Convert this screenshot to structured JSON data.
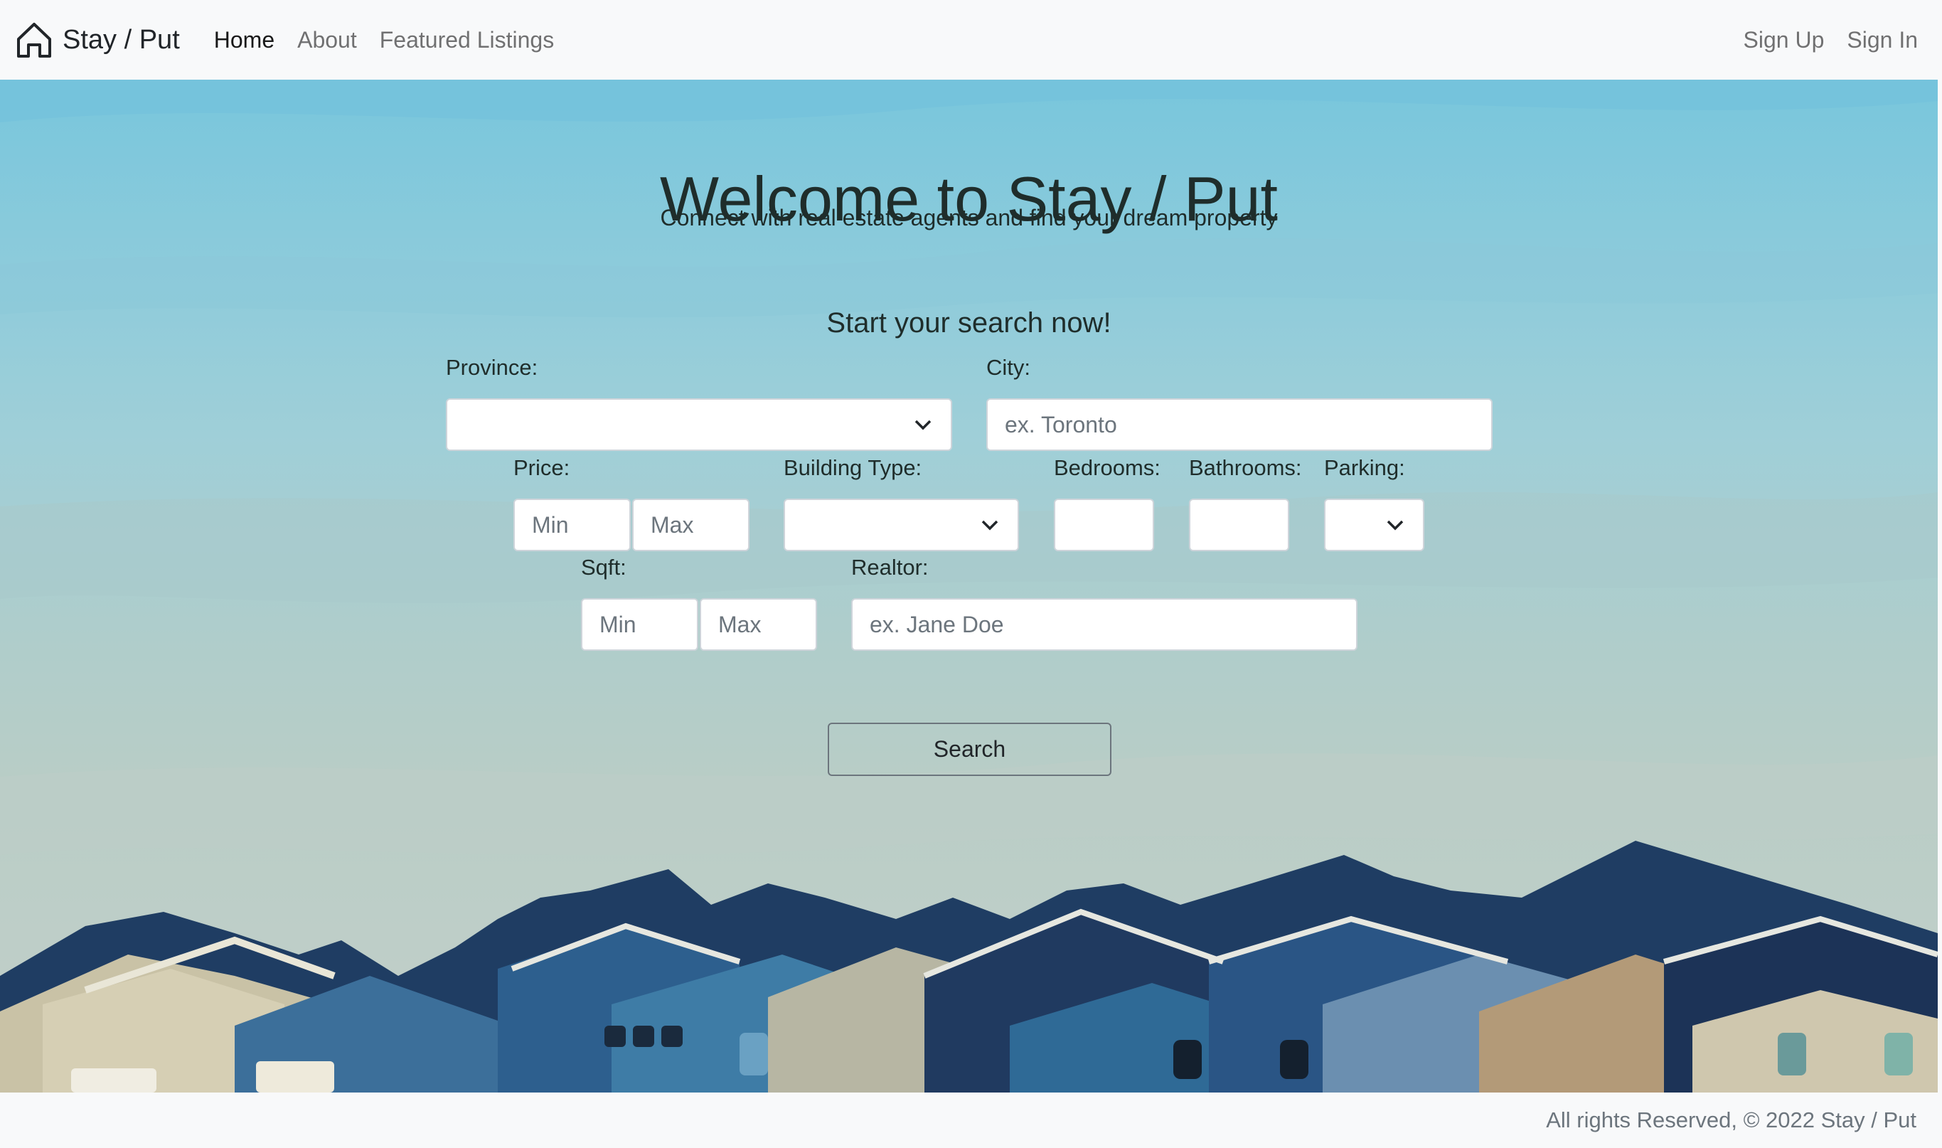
{
  "navbar": {
    "brand": "Stay / Put",
    "brand_icon": "house-icon",
    "links": [
      {
        "label": "Home",
        "active": true
      },
      {
        "label": "About",
        "active": false
      },
      {
        "label": "Featured Listings",
        "active": false
      }
    ],
    "auth": {
      "sign_up": "Sign Up",
      "sign_in": "Sign In"
    }
  },
  "hero": {
    "title": "Welcome to Stay / Put",
    "subtitle": "Connect with real estate agents and find your dream property"
  },
  "search": {
    "heading": "Start your search now!",
    "province": {
      "label": "Province:",
      "value": ""
    },
    "city": {
      "label": "City:",
      "placeholder": "ex. Toronto"
    },
    "price": {
      "label": "Price:",
      "min_placeholder": "Min",
      "max_placeholder": "Max"
    },
    "building_type": {
      "label": "Building Type:",
      "value": ""
    },
    "bedrooms": {
      "label": "Bedrooms:",
      "value": ""
    },
    "bathrooms": {
      "label": "Bathrooms:",
      "value": ""
    },
    "parking": {
      "label": "Parking:",
      "value": ""
    },
    "sqft": {
      "label": "Sqft:",
      "min_placeholder": "Min",
      "max_placeholder": "Max"
    },
    "realtor": {
      "label": "Realtor:",
      "placeholder": "ex. Jane Doe"
    },
    "button": "Search"
  },
  "footer": {
    "text": "All rights Reserved, © 2022 Stay / Put"
  },
  "colors": {
    "sky": "#78c6dc",
    "roof_dark": "#1c3357",
    "roof_mid": "#2f6a96",
    "footer_bg": "#f8f9fa"
  }
}
